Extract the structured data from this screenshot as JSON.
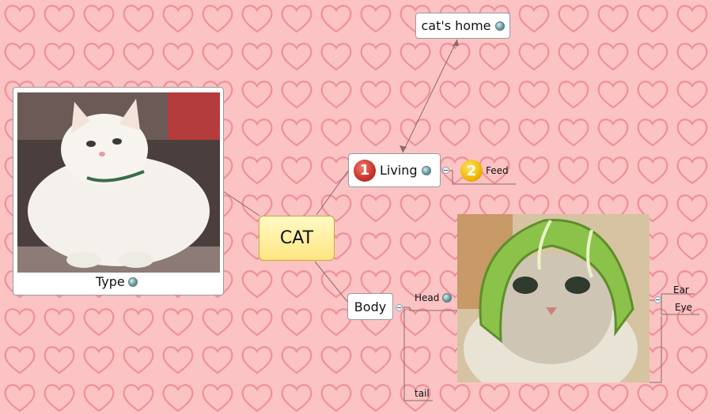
{
  "central": {
    "label": "CAT"
  },
  "type_topic": {
    "label": "Type",
    "image_desc": "white-cat-photo"
  },
  "living_topic": {
    "label": "Living",
    "marker": "1"
  },
  "feed_topic": {
    "label": "Feed",
    "marker": "2"
  },
  "home_topic": {
    "label": "cat's home"
  },
  "body_topic": {
    "label": "Body"
  },
  "head_topic": {
    "label": "Head",
    "image_desc": "cat-in-melon-helmet-photo"
  },
  "ear_topic": {
    "label": "Ear"
  },
  "eye_topic": {
    "label": "Eye"
  },
  "tail_topic": {
    "label": "tail"
  },
  "colors": {
    "background": "#fbc3c3",
    "heart": "#f08f9a",
    "central_fill": "#fff4a8",
    "marker1": "#c8322c",
    "marker2": "#f2b600",
    "connector": "#8a6a6a"
  }
}
